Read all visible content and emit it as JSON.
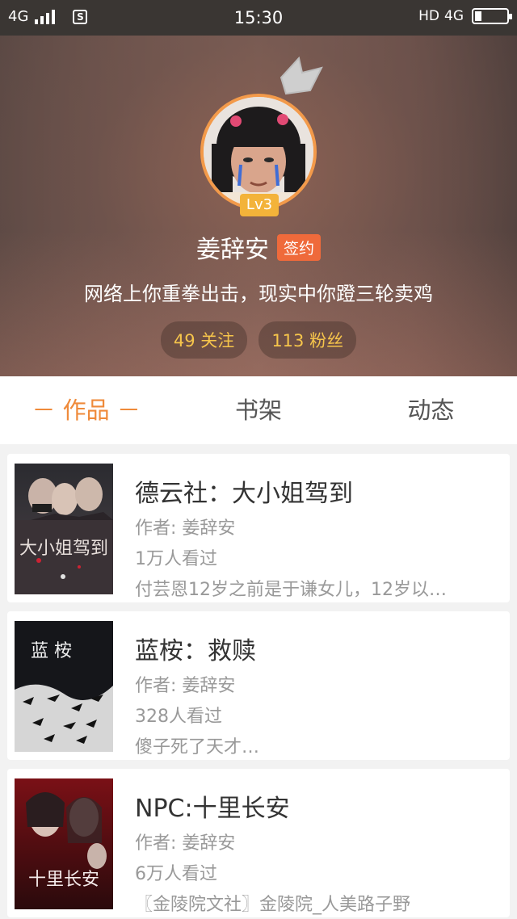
{
  "status_bar": {
    "network_left": "4G",
    "time": "15:30",
    "network_right_hd": "HD",
    "network_right": "4G",
    "s_icon": "S"
  },
  "profile": {
    "level": "Lv3",
    "name": "姜辞安",
    "sign_badge": "签约",
    "motto": "网络上你重拳出击，现实中你蹬三轮卖鸡",
    "following": "49 关注",
    "followers": "113 粉丝"
  },
  "tabs": [
    {
      "label": "－ 作品 －",
      "active": true
    },
    {
      "label": "书架",
      "active": false
    },
    {
      "label": "动态",
      "active": false
    }
  ],
  "books": [
    {
      "title": "德云社：大小姐驾到",
      "author": "作者: 姜辞安",
      "views": "1万人看过",
      "summary": "付芸恩12岁之前是于谦女儿，12岁以…",
      "cover_text": "大小姐驾到"
    },
    {
      "title": "蓝桉：救赎",
      "author": "作者: 姜辞安",
      "views": "328人看过",
      "summary": "傻子死了天才…",
      "cover_text": "蓝 桉"
    },
    {
      "title": "NPC:十里长安",
      "author": "作者: 姜辞安",
      "views": "6万人看过",
      "summary": "〖金陵院文社〗金陵院_人美路子野",
      "cover_text": "十里长安"
    }
  ],
  "colors": {
    "accent": "#ef8a3a",
    "level_badge": "#f3b33a",
    "sign_badge": "#ef6a3b",
    "stat_text": "#f6c54b"
  }
}
